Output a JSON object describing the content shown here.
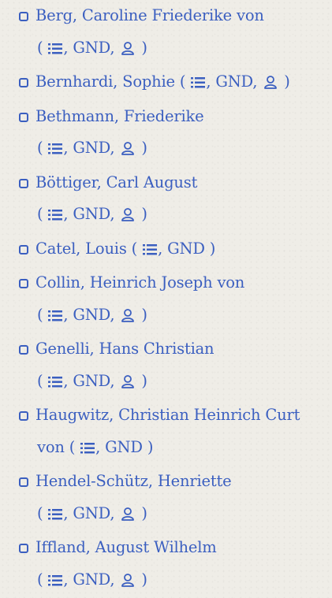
{
  "entries": [
    {
      "name": "Berg, Caroline Friederike von",
      "gnd": "GND",
      "has_person": true
    },
    {
      "name": "Bernhardi, Sophie",
      "gnd": "GND",
      "has_person": true
    },
    {
      "name": "Bethmann, Friederike",
      "gnd": "GND",
      "has_person": true
    },
    {
      "name": "Böttiger, Carl August",
      "gnd": "GND",
      "has_person": true
    },
    {
      "name": "Catel, Louis",
      "gnd": "GND",
      "has_person": false
    },
    {
      "name": "Collin, Heinrich Joseph von",
      "gnd": "GND",
      "has_person": true
    },
    {
      "name": "Genelli, Hans Christian",
      "gnd": "GND",
      "has_person": true
    },
    {
      "name": "Haugwitz, Christian Heinrich Curt",
      "name_cont": "von",
      "gnd": "GND",
      "has_person": false
    },
    {
      "name": "Hendel-Schütz, Henriette",
      "gnd": "GND",
      "has_person": true
    },
    {
      "name": "Iffland, August Wilhelm",
      "gnd": "GND",
      "has_person": true
    }
  ],
  "icons": {
    "checkbox": "checkbox-icon",
    "list": "list-icon",
    "person": "person-icon"
  },
  "colors": {
    "link": "#3b5fc0",
    "background": "#efede7"
  }
}
